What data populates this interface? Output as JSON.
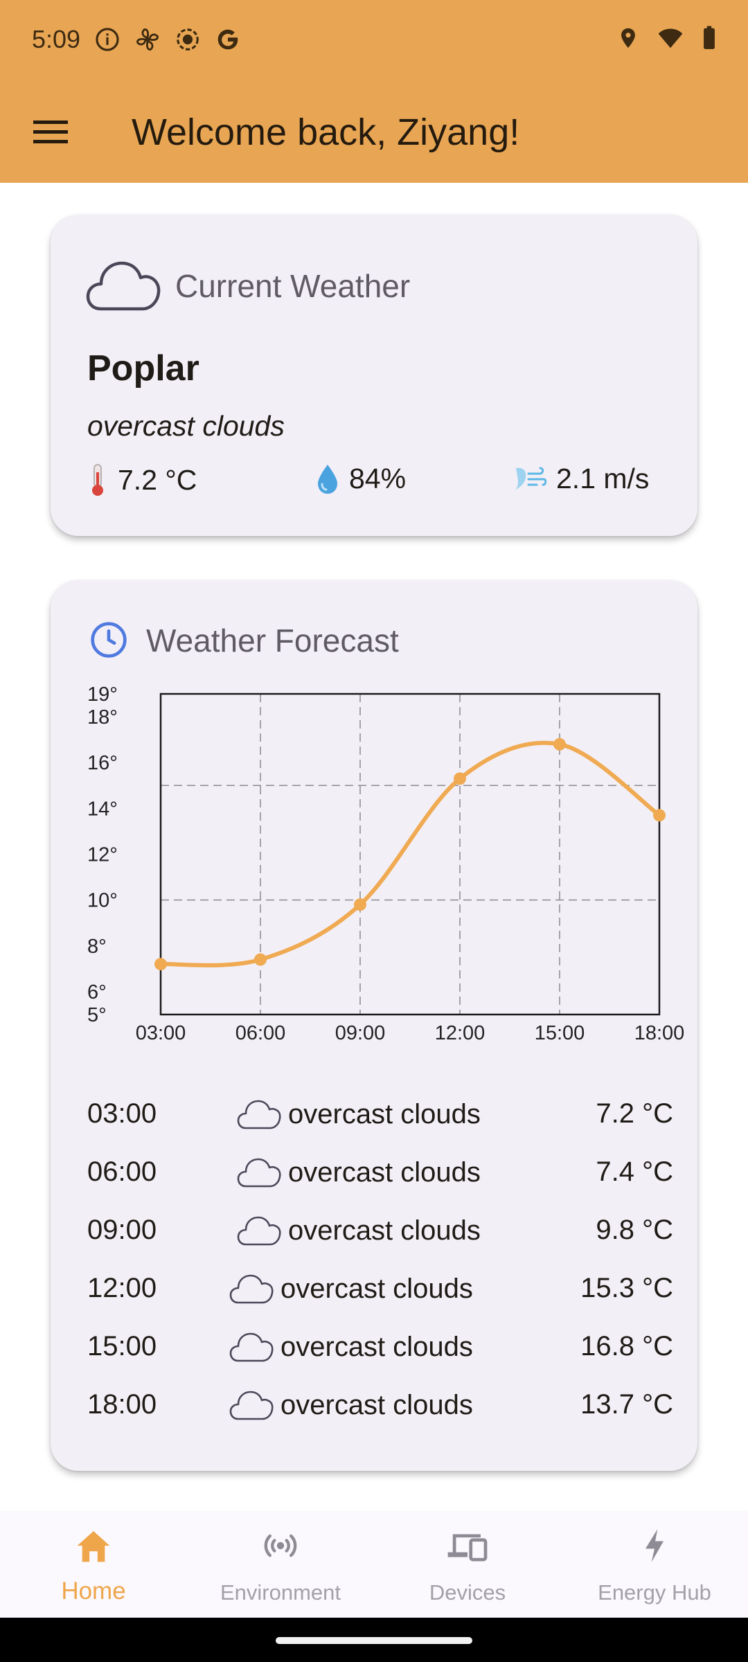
{
  "status_bar": {
    "time": "5:09"
  },
  "app_bar": {
    "title": "Welcome back, Ziyang!"
  },
  "current_weather": {
    "title": "Current Weather",
    "city": "Poplar",
    "description": "overcast clouds",
    "temperature": "7.2 °C",
    "humidity": "84%",
    "wind": "2.1 m/s"
  },
  "forecast": {
    "title": "Weather Forecast",
    "rows": [
      {
        "time": "03:00",
        "condition": "overcast clouds",
        "temp": "7.2 °C"
      },
      {
        "time": "06:00",
        "condition": "overcast clouds",
        "temp": "7.4 °C"
      },
      {
        "time": "09:00",
        "condition": "overcast clouds",
        "temp": "9.8 °C"
      },
      {
        "time": "12:00",
        "condition": "overcast clouds",
        "temp": "15.3 °C"
      },
      {
        "time": "15:00",
        "condition": "overcast clouds",
        "temp": "16.8 °C"
      },
      {
        "time": "18:00",
        "condition": "overcast clouds",
        "temp": "13.7 °C"
      }
    ]
  },
  "chart_data": {
    "type": "line",
    "x": [
      "03:00",
      "06:00",
      "09:00",
      "12:00",
      "15:00",
      "18:00"
    ],
    "series": [
      {
        "values": [
          7.2,
          7.4,
          9.8,
          15.3,
          16.8,
          13.7
        ]
      }
    ],
    "ylim": [
      5,
      19
    ],
    "y_ticks": [
      "19°",
      "18°",
      "16°",
      "14°",
      "12°",
      "10°",
      "8°",
      "6°",
      "5°"
    ],
    "y_tick_values": [
      19,
      18,
      16,
      14,
      12,
      10,
      8,
      6,
      5
    ],
    "grid": true,
    "line_color": "#EFAA52"
  },
  "nav": {
    "items": [
      {
        "label": "Home",
        "icon": "home-icon",
        "active": true
      },
      {
        "label": "Environment",
        "icon": "sensors-icon",
        "active": false
      },
      {
        "label": "Devices",
        "icon": "devices-icon",
        "active": false
      },
      {
        "label": "Energy Hub",
        "icon": "bolt-icon",
        "active": false
      }
    ]
  },
  "colors": {
    "accent": "#E8A654",
    "active_nav": "#EFA64A",
    "card_bg": "#f3eff7"
  }
}
